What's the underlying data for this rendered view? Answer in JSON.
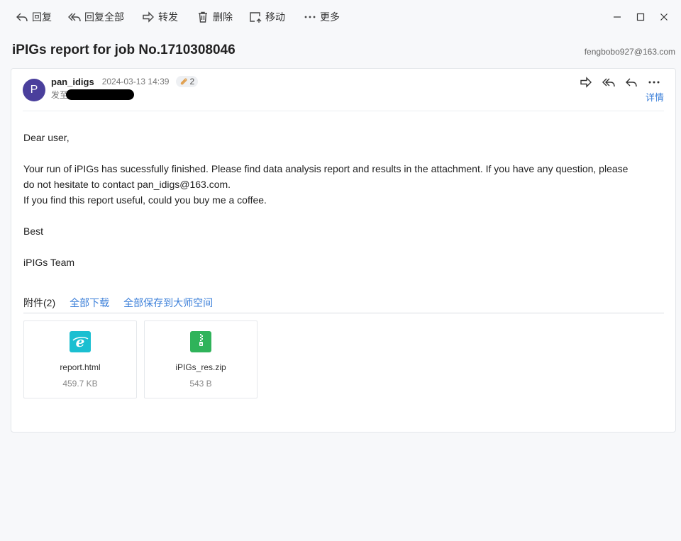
{
  "toolbar": {
    "reply_label": "回复",
    "reply_all_label": "回复全部",
    "forward_label": "转发",
    "delete_label": "删除",
    "move_label": "移动",
    "more_label": "更多"
  },
  "window": {
    "controls": [
      "minimize-icon",
      "maximize-icon",
      "close-icon"
    ]
  },
  "email": {
    "subject": "iPIGs report for job No.1710308046",
    "account": "fengbobo927@163.com",
    "avatar_letter": "P",
    "avatar_color": "#4a3f9c",
    "sender": "pan_idigs",
    "time": "2024-03-13 14:39",
    "attachment_count": "2",
    "to_label": "发至",
    "details_label": "详情",
    "body": {
      "greeting": "Dear user,",
      "line1": "Your run of iPIGs has sucessfully finished. Please find data analysis report and results in the attachment. If you have any question, please do not hesitate to contact pan_idigs@163.com.",
      "line2": "If you find this report useful, could you buy me a coffee.",
      "closing": "Best",
      "signature": "iPIGs Team"
    }
  },
  "attachments": {
    "header_label": "附件(2)",
    "download_all_label": "全部下载",
    "save_all_label": "全部保存到大师空间",
    "files": [
      {
        "name": "report.html",
        "size": "459.7 KB",
        "icon": "html-file-icon",
        "color": "#1bbfd1"
      },
      {
        "name": "iPIGs_res.zip",
        "size": "543 B",
        "icon": "zip-file-icon",
        "color": "#2fb35a"
      }
    ]
  },
  "colors": {
    "accent": "#3b7fd9",
    "background": "#f7f8fa"
  }
}
